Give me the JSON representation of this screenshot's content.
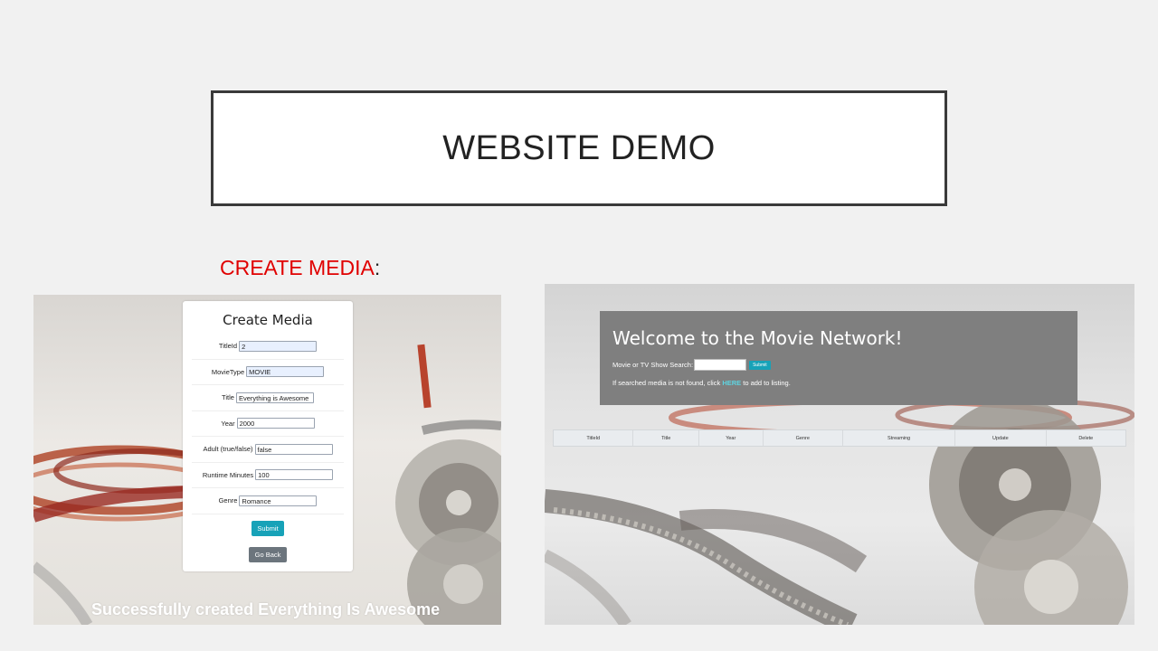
{
  "slide": {
    "title": "WEBSITE DEMO",
    "section_label_red": "CREATE MEDIA",
    "section_label_suffix": ":"
  },
  "create_form": {
    "heading": "Create Media",
    "fields": [
      {
        "label": "TitleId",
        "value": "2"
      },
      {
        "label": "MovieType",
        "value": "MOVIE"
      },
      {
        "label": "Title",
        "value": "Everything is Awesome"
      },
      {
        "label": "Year",
        "value": "2000"
      },
      {
        "label": "Adult (true/false)",
        "value": "false"
      },
      {
        "label": "Runtime Minutes",
        "value": "100"
      },
      {
        "label": "Genre",
        "value": "Romance"
      }
    ],
    "submit_label": "Submit",
    "back_label": "Go Back",
    "success_message": "Successfully created Everything Is Awesome"
  },
  "movie_network": {
    "welcome_title": "Welcome to the Movie Network!",
    "search_label": "Movie or TV Show Search:",
    "search_value": "",
    "search_button": "Submit",
    "notice_prefix": "If searched media is not found, click ",
    "notice_link": "HERE",
    "notice_suffix": " to add to listing.",
    "table_headers": [
      "TitleId",
      "Title",
      "Year",
      "Genre",
      "Streaming",
      "Update",
      "Delete"
    ]
  },
  "colors": {
    "accent_red": "#e00000",
    "button_teal": "#17a2b8",
    "button_gray": "#6c757d",
    "panel_gray": "#7f7f7f"
  }
}
